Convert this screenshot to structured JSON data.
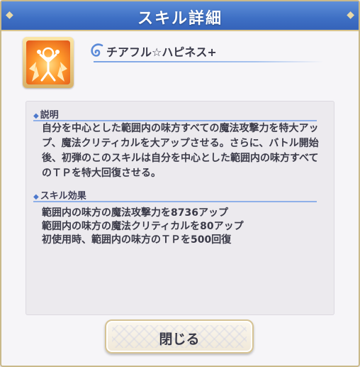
{
  "dialog": {
    "title": "スキル詳細"
  },
  "skill": {
    "icon": "flame-burst-icon",
    "name": "チアフル☆ハピネス+"
  },
  "description": {
    "heading": "説明",
    "text": "自分を中心とした範囲内の味方すべての魔法攻撃力を特大アップ、魔法クリティカルを大アップさせる。さらに、バトル開始後、初弾のこのスキルは自分を中心とした範囲内の味方すべてのＴＰを特大回復させる。"
  },
  "effects": {
    "heading": "スキル効果",
    "items": [
      "範囲内の味方の魔法攻撃力を8736アップ",
      "範囲内の味方の魔法クリティカルを80アップ",
      "初使用時、範囲内の味方のＴＰを500回復"
    ]
  },
  "buttons": {
    "close_label": "閉じる"
  },
  "colors": {
    "header": "#3e6fc4",
    "accent_line": "#8fb0e8",
    "border_gold": "#c9b98a"
  }
}
